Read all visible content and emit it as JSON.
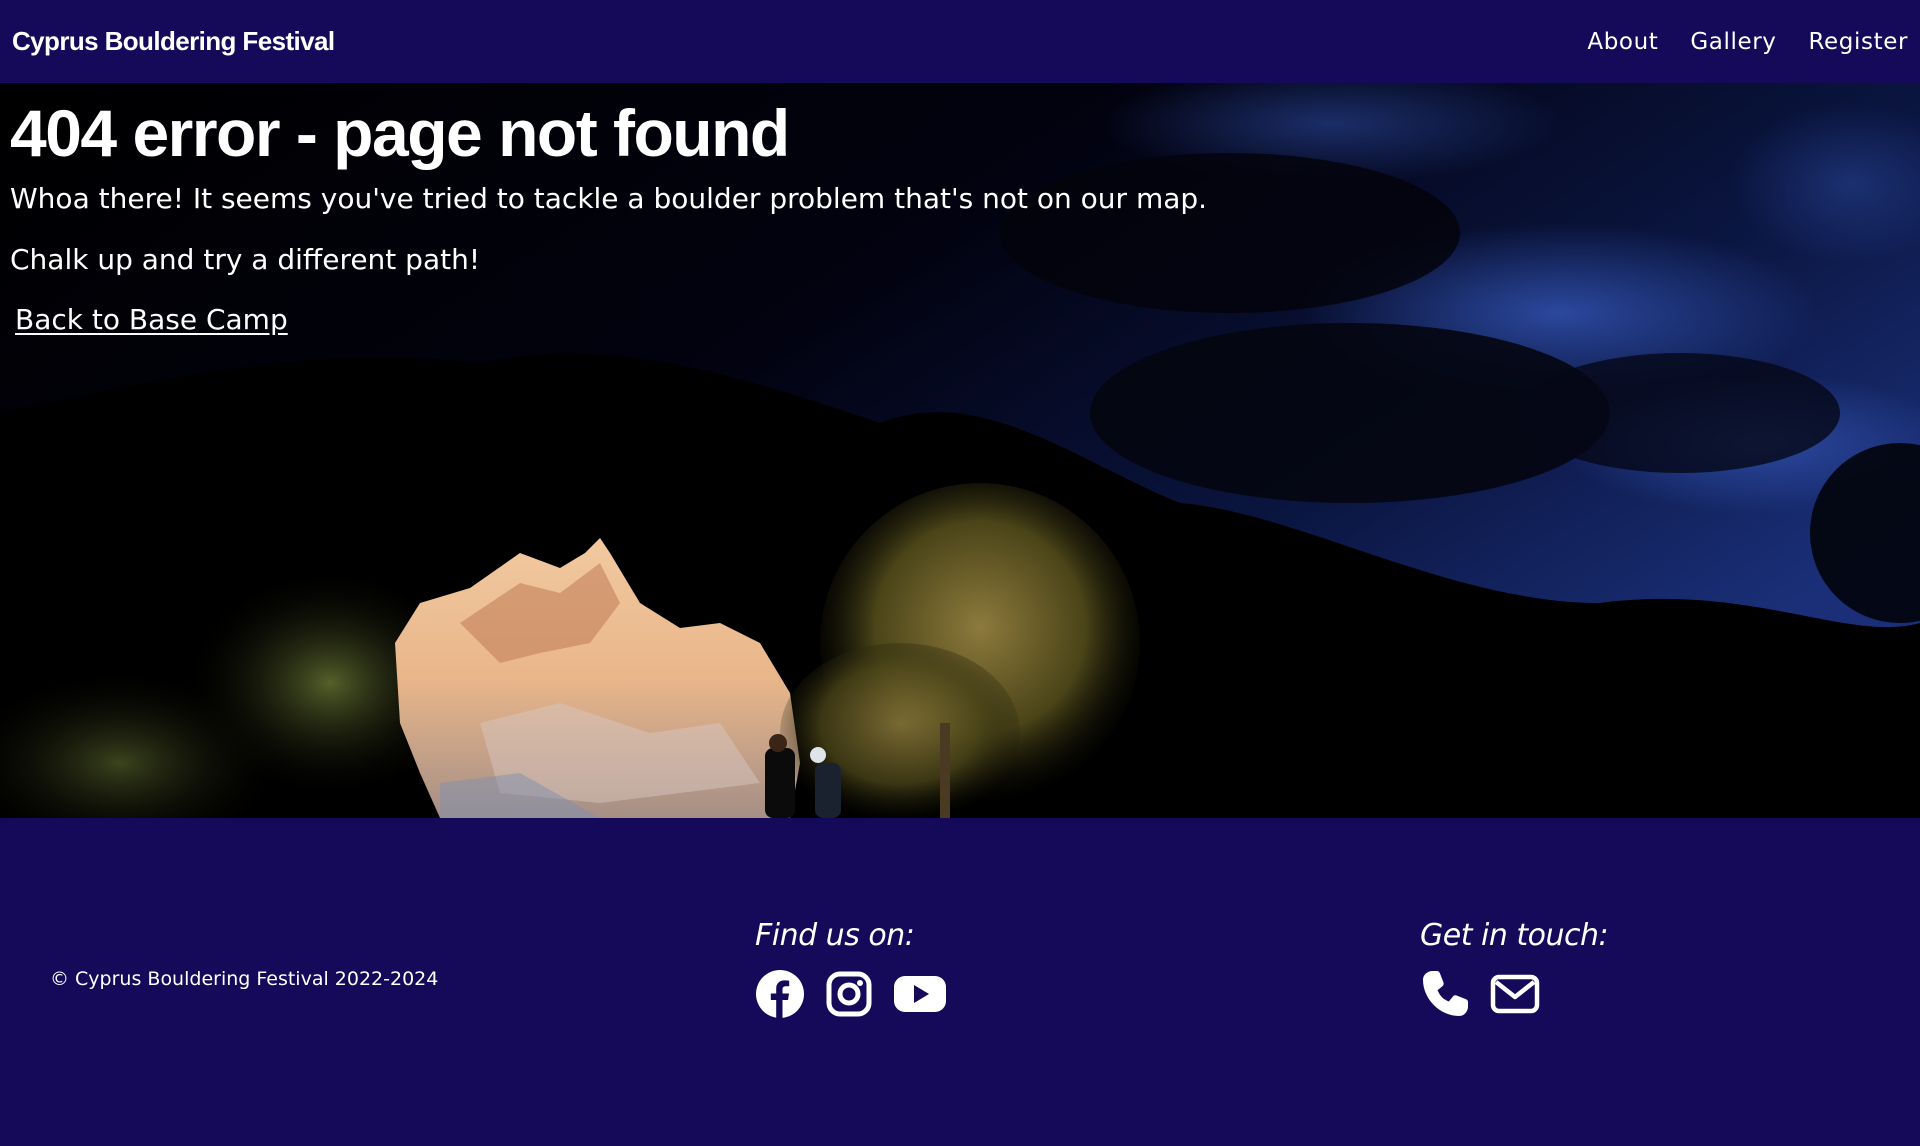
{
  "header": {
    "brand": "Cyprus Bouldering Festival",
    "nav": [
      "About",
      "Gallery",
      "Register"
    ]
  },
  "hero": {
    "title": "404 error - page not found",
    "line1": "Whoa there! It seems you've tried to tackle a boulder problem that's not on our map.",
    "line2": "Chalk up and try a different path!",
    "back_link": "Back to Base Camp"
  },
  "footer": {
    "copyright": "© Cyprus Bouldering Festival 2022-2024",
    "social_heading": "Find us on:",
    "social_icons": [
      "facebook-icon",
      "instagram-icon",
      "youtube-icon"
    ],
    "contact_heading": "Get in touch:",
    "contact_icons": [
      "phone-icon",
      "envelope-icon"
    ]
  },
  "colors": {
    "bar_background": "#150959",
    "text": "#ffffff"
  }
}
